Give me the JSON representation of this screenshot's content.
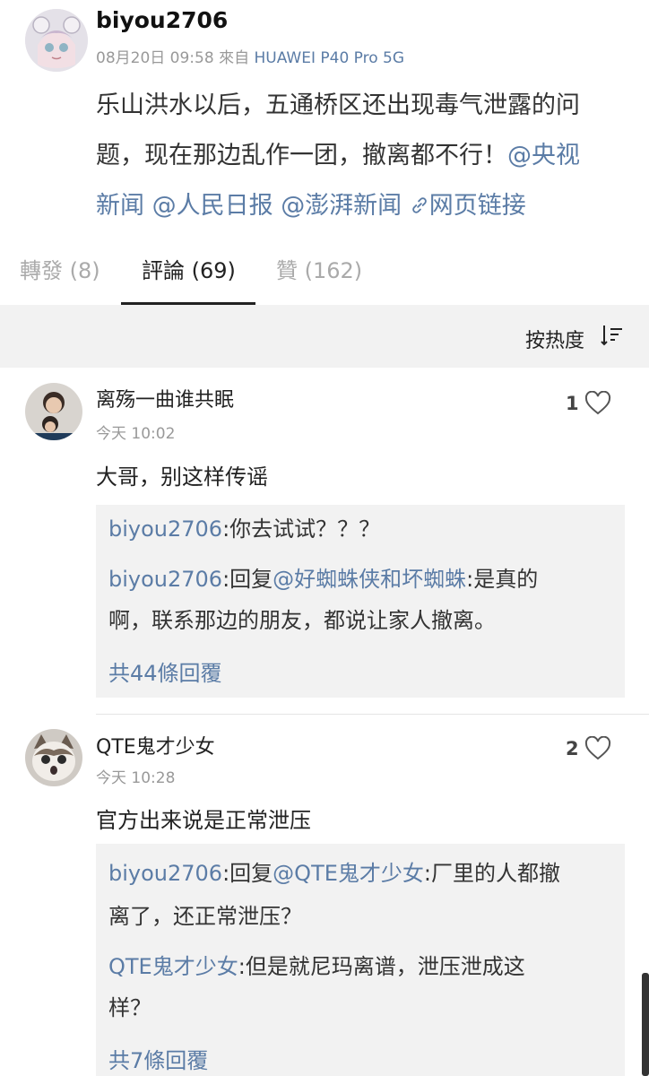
{
  "post": {
    "username": "biyou2706",
    "timestamp": "08月20日 09:58",
    "source_prefix": "來自",
    "device": "HUAWEI P40 Pro 5G",
    "body_line1": "乐山洪水以后，五通桥区还出现毒气泄露的问",
    "body_line2_text": "题，现在那边乱作一团，撤离都不行！",
    "mention1": "@央视",
    "mention1_cont": "新闻",
    "mention2": "@人民日报",
    "mention3": "@澎湃新闻",
    "web_link": "网页链接"
  },
  "tabs": [
    {
      "label": "轉發 (8)"
    },
    {
      "label": "評論 (69)"
    },
    {
      "label": "贊 (162)"
    }
  ],
  "sort": {
    "label": "按热度"
  },
  "comments": [
    {
      "name": "离殇一曲谁共眠",
      "time": "今天 10:02",
      "likes": "1",
      "text": "大哥，别这样传谣",
      "replies": [
        {
          "user": "biyou2706",
          "sep": ":",
          "text": "你去试试？？？"
        },
        {
          "user": "biyou2706",
          "sep": ":回复",
          "mention": "@好蜘蛛侠和坏蜘蛛",
          "text_a": ":是真的",
          "text_b": "啊，联系那边的朋友，都说让家人撤离。"
        }
      ],
      "more": "共44條回覆"
    },
    {
      "name": "QTE鬼才少女",
      "time": "今天 10:28",
      "likes": "2",
      "text": "官方出来说是正常泄压",
      "replies": [
        {
          "user": "biyou2706",
          "sep": ":回复",
          "mention": "@QTE鬼才少女",
          "text_a": ":厂里的人都撤",
          "text_b": "离了，还正常泄压？"
        },
        {
          "user": "QTE鬼才少女",
          "sep": ":",
          "text_a": "但是就尼玛离谱，泄压泄成这",
          "text_b": "样？"
        }
      ],
      "more": "共7條回覆"
    }
  ],
  "icons": {
    "heart": "heart-icon",
    "sort": "sort-icon",
    "link": "link-icon"
  },
  "colors": {
    "link": "#5b7ca6",
    "muted": "#999999",
    "panel": "#f2f2f2"
  }
}
